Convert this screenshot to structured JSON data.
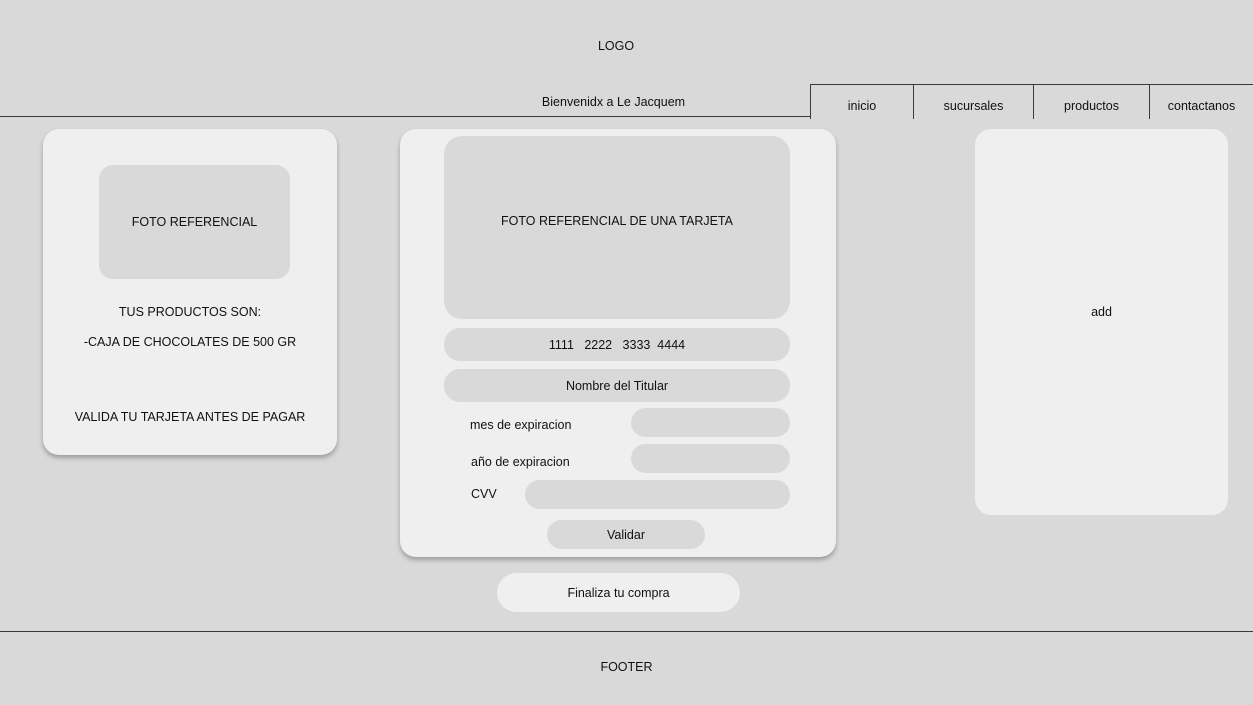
{
  "header": {
    "logo_text": "LOGO",
    "welcome_text": "Bienvenidx a Le Jacquem"
  },
  "nav": {
    "items": [
      {
        "label": "inicio"
      },
      {
        "label": "sucursales"
      },
      {
        "label": "productos"
      },
      {
        "label": "contactanos"
      }
    ]
  },
  "summary_card": {
    "photo_text": "FOTO REFERENCIAL",
    "products_heading": "TUS PRODUCTOS SON:",
    "product_item": "-CAJA DE CHOCOLATES DE 500 GR",
    "notice": "VALIDA TU TARJETA ANTES DE PAGAR"
  },
  "payment_card": {
    "photo_text": "FOTO REFERENCIAL DE UNA TARJETA",
    "card_number_placeholder": "1111   2222   3333  4444",
    "holder_placeholder": "Nombre del Titular",
    "month_label": "mes de expiracion",
    "year_label": "año de expiracion",
    "cvv_label": "CVV",
    "validate_label": "Validar"
  },
  "ad_panel": {
    "text": "add"
  },
  "finish_button": {
    "label": "Finaliza tu compra"
  },
  "footer": {
    "text": "FOOTER"
  }
}
